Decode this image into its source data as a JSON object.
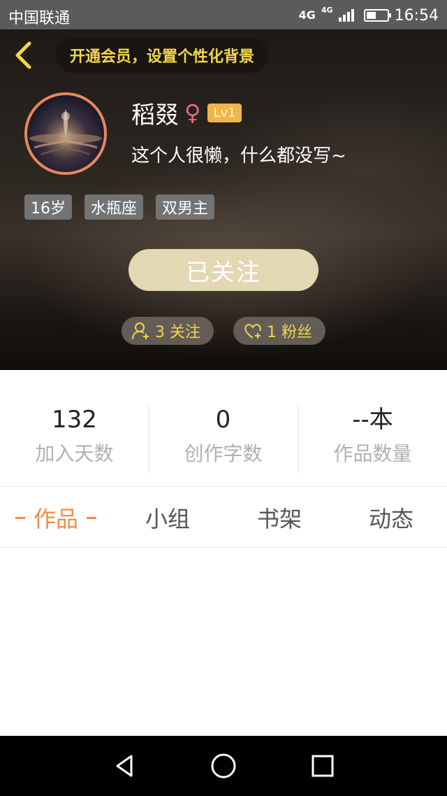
{
  "status_bar": {
    "carrier": "中国联通",
    "network_primary": "4G",
    "network_secondary": "4G",
    "time": "16:54",
    "battery_level": 0.45,
    "icons": [
      "signal-icon",
      "battery-icon"
    ]
  },
  "header": {
    "back_icon": "chevron-left-icon",
    "vip_prompt": "开通会员，设置个性化背景",
    "user": {
      "name": "稻叕",
      "gender_symbol": "♀",
      "level": "Lv1",
      "bio": "这个人很懒，什么都没写~"
    },
    "tags": [
      "16岁",
      "水瓶座",
      "双男主"
    ],
    "follow_button": "已关注",
    "following": {
      "icon": "user-add-icon",
      "text": "3 关注"
    },
    "fans": {
      "icon": "heart-add-icon",
      "text": "1 粉丝"
    }
  },
  "stats": [
    {
      "value": "132",
      "label": "加入天数"
    },
    {
      "value": "0",
      "label": "创作字数"
    },
    {
      "value": "--本",
      "label": "作品数量"
    }
  ],
  "tabs": [
    {
      "label": "作品",
      "active": true
    },
    {
      "label": "小组",
      "active": false
    },
    {
      "label": "书架",
      "active": false
    },
    {
      "label": "动态",
      "active": false
    }
  ],
  "nav_bar": {
    "icons": [
      "back-triangle-icon",
      "home-circle-icon",
      "recents-square-icon"
    ]
  },
  "colors": {
    "accent_orange": "#f28a4a",
    "accent_yellow": "#f3d64b",
    "follow_button": "#e3d8b4",
    "level_badge": "#f0b64a",
    "avatar_ring": "#e8875e"
  }
}
